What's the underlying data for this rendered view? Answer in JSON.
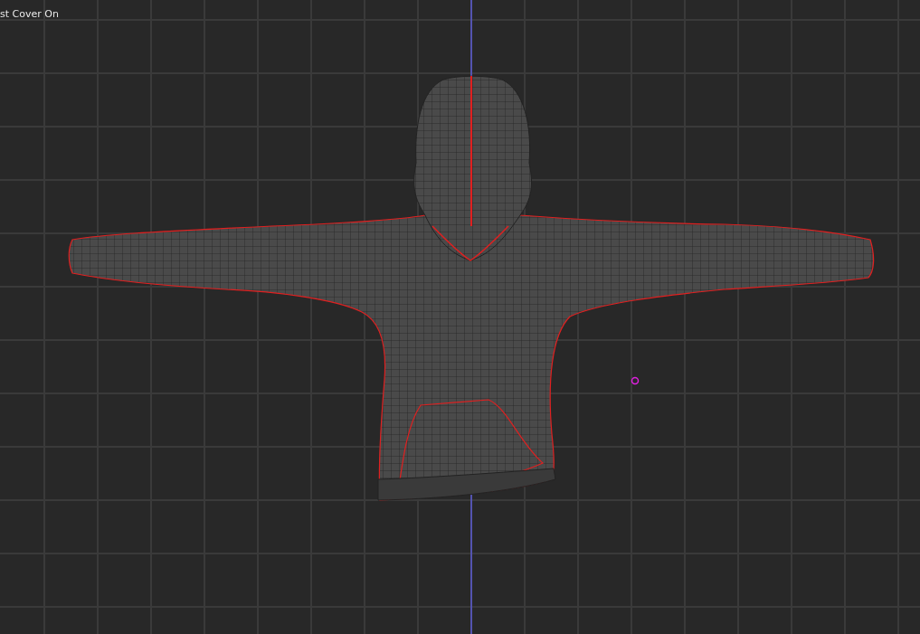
{
  "viewport": {
    "overlay_text": "st Cover On"
  }
}
